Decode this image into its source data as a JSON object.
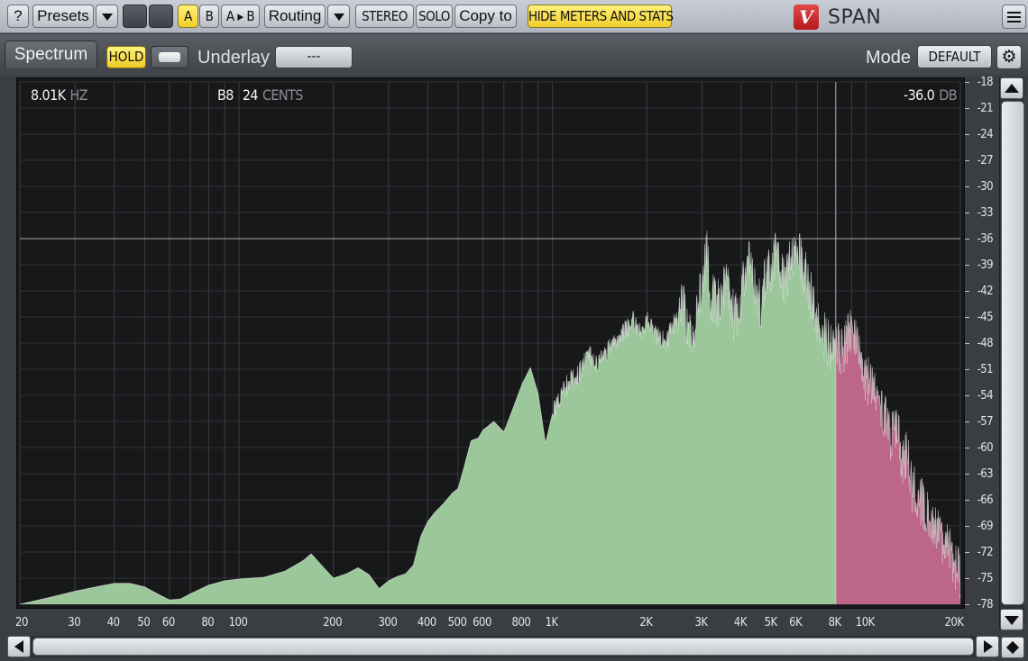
{
  "toolbar": {
    "help_label": "?",
    "presets_label": "Presets",
    "a_label": "A",
    "b_label": "B",
    "a_to_b_label": "A ▸ B",
    "routing_label": "Routing",
    "stereo_label": "STEREO",
    "solo_label": "SOLO",
    "copy_to_label": "Copy to",
    "hide_meters_label": "HIDE METERS AND STATS",
    "logo_text": "SPAN"
  },
  "controls": {
    "spectrum_tab_label": "Spectrum",
    "hold_label": "HOLD",
    "underlay_label": "Underlay",
    "underlay_value": "---",
    "mode_label": "Mode",
    "mode_value": "DEFAULT"
  },
  "readout": {
    "frequency_value": "8.01K",
    "frequency_unit": "HZ",
    "note_value": "B8",
    "cents_value": "24",
    "cents_unit": "CENTS",
    "level_value": "-36.0",
    "level_unit": "DB"
  },
  "colors": {
    "spectrum_fill": "#9bc79a",
    "spectrum_highlight_fill": "#bd6788",
    "background": "#17181a",
    "accent_yellow": "#f5d535"
  },
  "chart_data": {
    "type": "area",
    "x_scale": "log",
    "xlim": [
      20,
      20000
    ],
    "ylim": [
      -78,
      -18
    ],
    "x_tick_labels": [
      "20",
      "30",
      "40",
      "50",
      "60",
      "80",
      "100",
      "200",
      "300",
      "400",
      "500",
      "600",
      "800",
      "1K",
      "2K",
      "3K",
      "4K",
      "5K",
      "6K",
      "8K",
      "10K",
      "20K"
    ],
    "y_tick_labels": [
      "-18",
      "-21",
      "-24",
      "-27",
      "-30",
      "-33",
      "-36",
      "-39",
      "-42",
      "-45",
      "-48",
      "-51",
      "-54",
      "-57",
      "-60",
      "-63",
      "-66",
      "-69",
      "-72",
      "-75",
      "-78"
    ],
    "cursor": {
      "freq_hz": 8010,
      "db": -36.0
    },
    "highlight_from_hz": 8000,
    "x": [
      20,
      25,
      30,
      35,
      40,
      45,
      50,
      55,
      60,
      65,
      70,
      80,
      90,
      100,
      120,
      140,
      160,
      170,
      180,
      200,
      220,
      240,
      260,
      280,
      300,
      320,
      340,
      360,
      380,
      400,
      420,
      450,
      480,
      500,
      520,
      550,
      580,
      600,
      650,
      700,
      750,
      800,
      850,
      900,
      950,
      1000,
      1100,
      1200,
      1300,
      1400,
      1500,
      1600,
      1700,
      1800,
      1900,
      2000,
      2150,
      2300,
      2450,
      2600,
      2800,
      2900,
      3000,
      3100,
      3200,
      3400,
      3600,
      3800,
      4000,
      4200,
      4400,
      4600,
      4800,
      5000,
      5200,
      5500,
      5800,
      6000,
      6300,
      6600,
      7000,
      7400,
      7800,
      8000,
      8300,
      8700,
      9100,
      9500,
      10000,
      10500,
      11000,
      11500,
      12000,
      12500,
      13000,
      13500,
      14000,
      15000,
      16000,
      17000,
      18000,
      19000,
      20000
    ],
    "values": [
      -78,
      -77.2,
      -76.5,
      -76,
      -75.6,
      -75.6,
      -76,
      -76.8,
      -77.5,
      -77.4,
      -76.8,
      -75.8,
      -75.3,
      -75.1,
      -74.9,
      -74.2,
      -73,
      -72.2,
      -73.2,
      -75,
      -74.5,
      -73.8,
      -74.6,
      -76.2,
      -75.3,
      -74.8,
      -74.5,
      -73.5,
      -70.2,
      -68.5,
      -67.5,
      -66.4,
      -65.2,
      -64.7,
      -62.5,
      -59.2,
      -58.9,
      -58,
      -57,
      -58.2,
      -55.4,
      -52.7,
      -50.8,
      -53.8,
      -59.5,
      -56.1,
      -52.8,
      -51.6,
      -49.3,
      -50.2,
      -48.7,
      -47.8,
      -46.5,
      -45.3,
      -46.5,
      -45.4,
      -47.1,
      -47.8,
      -45.6,
      -43.2,
      -48.2,
      -43.8,
      -40.6,
      -37.2,
      -42.3,
      -43.3,
      -39.6,
      -45.2,
      -42.3,
      -38.4,
      -40.5,
      -43.5,
      -39.1,
      -38.8,
      -36.8,
      -41.1,
      -37.2,
      -37.5,
      -38.8,
      -41.6,
      -45.2,
      -47.1,
      -48.1,
      -47,
      -49.2,
      -47.3,
      -46.1,
      -48.5,
      -52.4,
      -52,
      -55.2,
      -56.6,
      -58.4,
      -57.3,
      -61,
      -60.4,
      -64.4,
      -65.8,
      -68.5,
      -69.4,
      -71.1,
      -72.6,
      -74.2
    ]
  }
}
